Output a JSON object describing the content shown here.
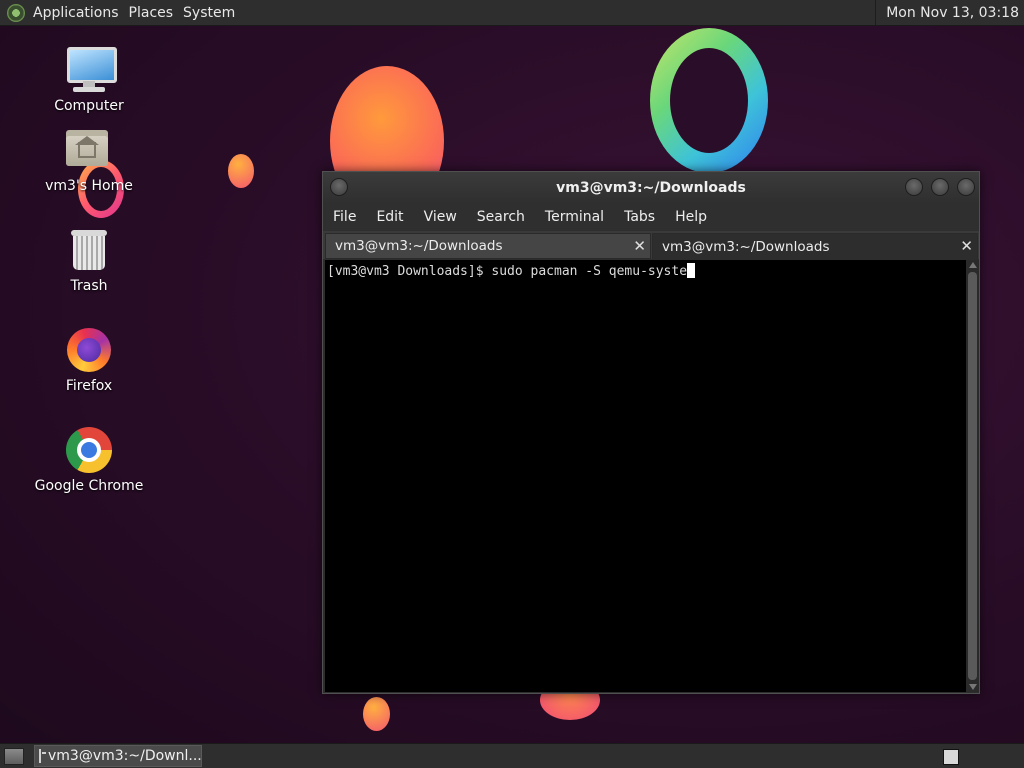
{
  "top_panel": {
    "menus": [
      "Applications",
      "Places",
      "System"
    ],
    "clock": "Mon Nov 13, 03:18"
  },
  "desktop_icons": [
    {
      "label": "Computer",
      "icon": "computer-icon"
    },
    {
      "label": "vm3's Home",
      "icon": "home-folder-icon"
    },
    {
      "label": "Trash",
      "icon": "trash-icon"
    },
    {
      "label": "Firefox",
      "icon": "firefox-icon"
    },
    {
      "label": "Google Chrome",
      "icon": "chrome-icon"
    }
  ],
  "terminal": {
    "title": "vm3@vm3:~/Downloads",
    "menu": [
      "File",
      "Edit",
      "View",
      "Search",
      "Terminal",
      "Tabs",
      "Help"
    ],
    "tabs": [
      {
        "label": "vm3@vm3:~/Downloads",
        "active": false
      },
      {
        "label": "vm3@vm3:~/Downloads",
        "active": true
      }
    ],
    "prompt": "[vm3@vm3 Downloads]$ ",
    "command": "sudo pacman -S qemu-syste"
  },
  "bottom_panel": {
    "task_label": "vm3@vm3:~/Downl..."
  },
  "colors": {
    "wallpaper": "#2a0d28",
    "panel": "#2e2e2e",
    "terminal_bg": "#000000"
  }
}
